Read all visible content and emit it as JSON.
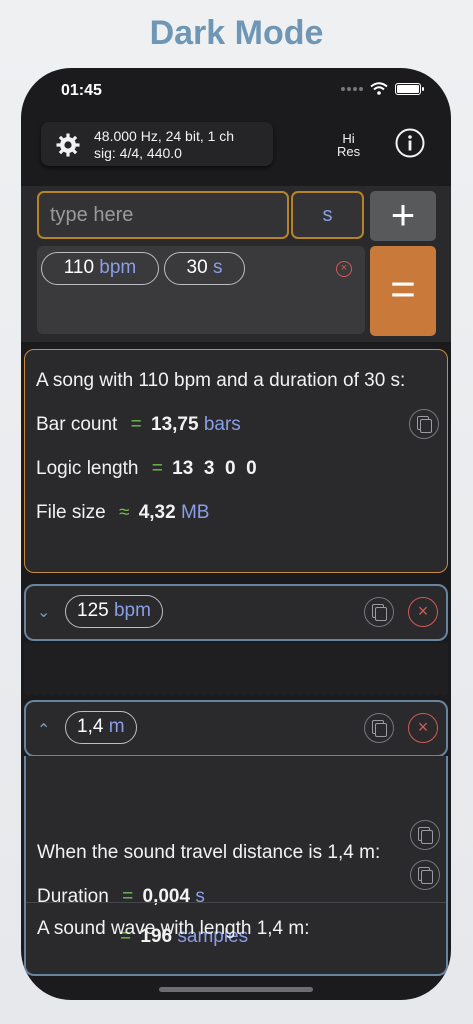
{
  "page_title": "Dark Mode",
  "status": {
    "time": "01:45"
  },
  "header": {
    "settings_line1": "48.000 Hz, 24 bit, 1 ch",
    "settings_line2": "sig: 4/4, 440.0",
    "hires_line1": "Hi",
    "hires_line2": "Res"
  },
  "input": {
    "placeholder": "type here",
    "unit": "s",
    "plus_label": "+",
    "equals_label": "=",
    "clear_label": "×",
    "tokens": [
      {
        "value": "110",
        "unit": "bpm"
      },
      {
        "value": "30",
        "unit": "s"
      }
    ]
  },
  "song_card": {
    "headline": "A song with 110 bpm and a duration of 30 s:",
    "rows": [
      {
        "label": "Bar count",
        "op": "=",
        "value": "13,75",
        "unit": "bars"
      },
      {
        "label": "Logic length",
        "op": "=",
        "value": "13  3  0  0",
        "unit": ""
      },
      {
        "label": "File size",
        "op": "≈",
        "value": "4,32",
        "unit": "MB"
      }
    ]
  },
  "bpm_card": {
    "chevron": "⌄",
    "value": "125",
    "unit": "bpm",
    "delete_label": "×"
  },
  "distance_card": {
    "chevron": "⌃",
    "value": "1,4",
    "unit": "m",
    "delete_label": "×",
    "headline": "When the sound travel distance is 1,4 m:",
    "duration_label": "Duration",
    "duration_op": "=",
    "duration_value": "0,004",
    "duration_unit": "s",
    "samples_op": "=",
    "samples_value": "196",
    "samples_unit": "samples",
    "wave_headline": "A sound wave with length 1,4 m:"
  }
}
